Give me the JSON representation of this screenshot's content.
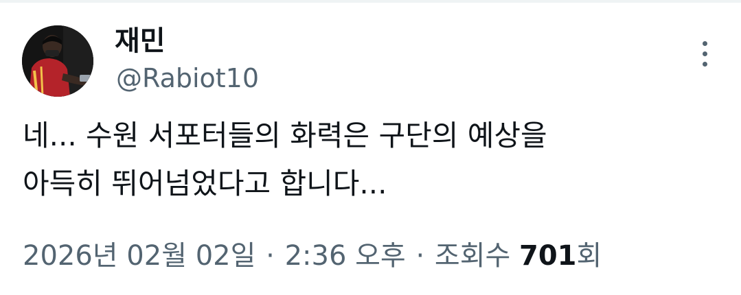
{
  "tweet": {
    "author": {
      "display_name": "재민",
      "handle": "@Rabiot10",
      "avatar_icon": "profile-photo"
    },
    "more_icon": "more-vertical-icon",
    "text_lines": [
      "네... 수원 서포터들의 화력은 구단의 예상을",
      "아득히 뛰어넘었다고 합니다..."
    ],
    "meta": {
      "date": "2026년 02월 02일",
      "separator": "·",
      "time": "2:36 오후",
      "views_label": "조회수",
      "views_count": "701",
      "views_suffix": "회"
    }
  },
  "colors": {
    "primary_text": "#0f1419",
    "secondary_text": "#536471",
    "divider": "#eff3f4"
  }
}
